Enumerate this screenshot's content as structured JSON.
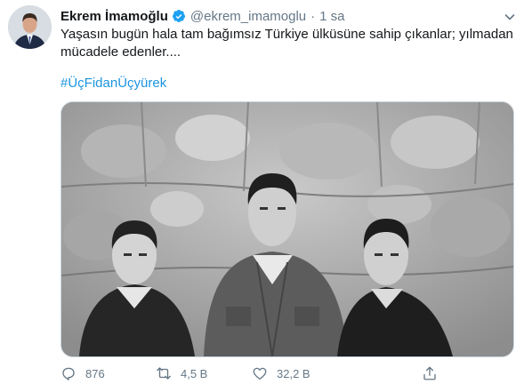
{
  "tweet": {
    "author_name": "Ekrem İmamoğlu",
    "handle": "@ekrem_imamoglu",
    "separator": "·",
    "time": "1 sa",
    "text": "Yaşasın bugün hala tam bağımsız Türkiye ülküsüne sahip çıkanlar; yılmadan mücadele edenler....",
    "hashtag": "#ÜçFidanÜçyürek"
  },
  "icons": {
    "verified": "verified-badge-icon",
    "caret": "chevron-down-icon",
    "reply": "reply-icon",
    "retweet": "retweet-icon",
    "like": "like-icon",
    "share": "share-icon"
  },
  "stats": {
    "replies": "876",
    "retweets": "4,5 B",
    "likes": "32,2 B"
  },
  "colors": {
    "link": "#1b95e0",
    "verified": "#1da1f2",
    "muted": "#657786"
  }
}
